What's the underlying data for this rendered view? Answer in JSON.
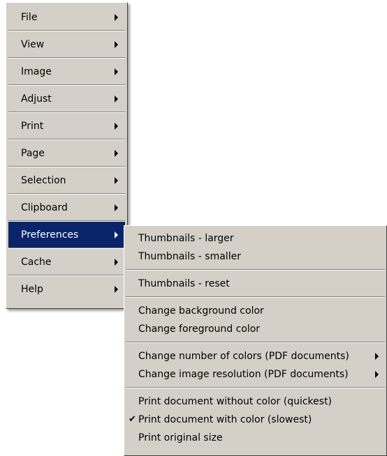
{
  "main_menu": {
    "items": [
      {
        "label": "File",
        "has_submenu": true
      },
      {
        "label": "View",
        "has_submenu": true
      },
      {
        "label": "Image",
        "has_submenu": true
      },
      {
        "label": "Adjust",
        "has_submenu": true
      },
      {
        "label": "Print",
        "has_submenu": true
      },
      {
        "label": "Page",
        "has_submenu": true
      },
      {
        "label": "Selection",
        "has_submenu": true
      },
      {
        "label": "Clipboard",
        "has_submenu": true
      },
      {
        "label": "Preferences",
        "has_submenu": true,
        "highlighted": true
      },
      {
        "label": "Cache",
        "has_submenu": true
      },
      {
        "label": "Help",
        "has_submenu": true
      }
    ]
  },
  "preferences_menu": {
    "groups": [
      [
        {
          "label": "Thumbnails - larger"
        },
        {
          "label": "Thumbnails - smaller"
        }
      ],
      [
        {
          "label": "Thumbnails - reset"
        }
      ],
      [
        {
          "label": "Change background color"
        },
        {
          "label": "Change foreground color"
        }
      ],
      [
        {
          "label": "Change number of colors (PDF documents)",
          "has_submenu": true
        },
        {
          "label": "Change image resolution (PDF documents)",
          "has_submenu": true
        }
      ],
      [
        {
          "label": "Print document without color (quickest)"
        },
        {
          "label": "Print document with color (slowest)",
          "checked": true,
          "check_glyph": "✔"
        },
        {
          "label": "Print original size"
        }
      ]
    ]
  },
  "colors": {
    "menu_bg": "#d4d0c8",
    "highlight_bg": "#0a246a",
    "highlight_fg": "#ffffff"
  }
}
